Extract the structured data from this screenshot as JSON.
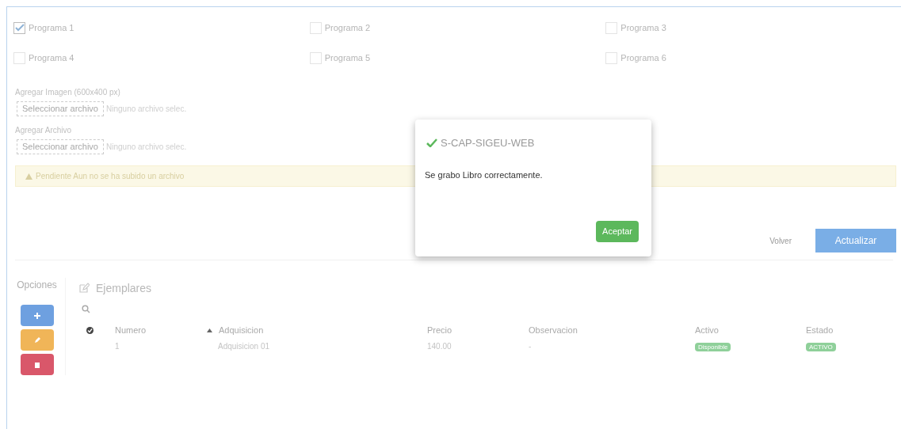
{
  "programs": [
    {
      "label": "Programa 1",
      "checked": true
    },
    {
      "label": "Programa 2",
      "checked": false
    },
    {
      "label": "Programa 3",
      "checked": false
    },
    {
      "label": "Programa 4",
      "checked": false
    },
    {
      "label": "Programa 5",
      "checked": false
    },
    {
      "label": "Programa 6",
      "checked": false
    }
  ],
  "uploads": [
    {
      "label": "Agregar Imagen (600x400 px)",
      "button": "Seleccionar archivo",
      "status": "Ninguno archivo selec."
    },
    {
      "label": "Agregar Archivo",
      "button": "Seleccionar archivo",
      "status": "Ninguno archivo selec."
    }
  ],
  "warning": "Pendiente Aun no se ha subido un archivo",
  "actions": [
    {
      "label": "Volver",
      "kind": "link"
    },
    {
      "label": "Actualizar",
      "kind": "primary"
    }
  ],
  "options": {
    "title": "Opciones",
    "buttons": [
      {
        "kind": "add"
      },
      {
        "kind": "edit"
      },
      {
        "kind": "delete"
      }
    ]
  },
  "ejemplares": {
    "title": "Ejemplares",
    "columns": [
      {
        "label": "Numero",
        "sort": false
      },
      {
        "label": "Adquisicion",
        "sort": true
      },
      {
        "label": "Precio",
        "sort": false
      },
      {
        "label": "Observacion",
        "sort": false
      },
      {
        "label": "Activo",
        "sort": false
      },
      {
        "label": "Estado",
        "sort": false
      }
    ],
    "rows": [
      {
        "cells": [
          "1",
          "Adquisicion 01",
          "140.00",
          "-"
        ],
        "activo": "Disponible",
        "estado": "ACTIVO"
      }
    ]
  },
  "modal": {
    "title": "S-CAP-SIGEU-WEB",
    "message": "Se grabo Libro correctamente.",
    "button": "Aceptar"
  }
}
